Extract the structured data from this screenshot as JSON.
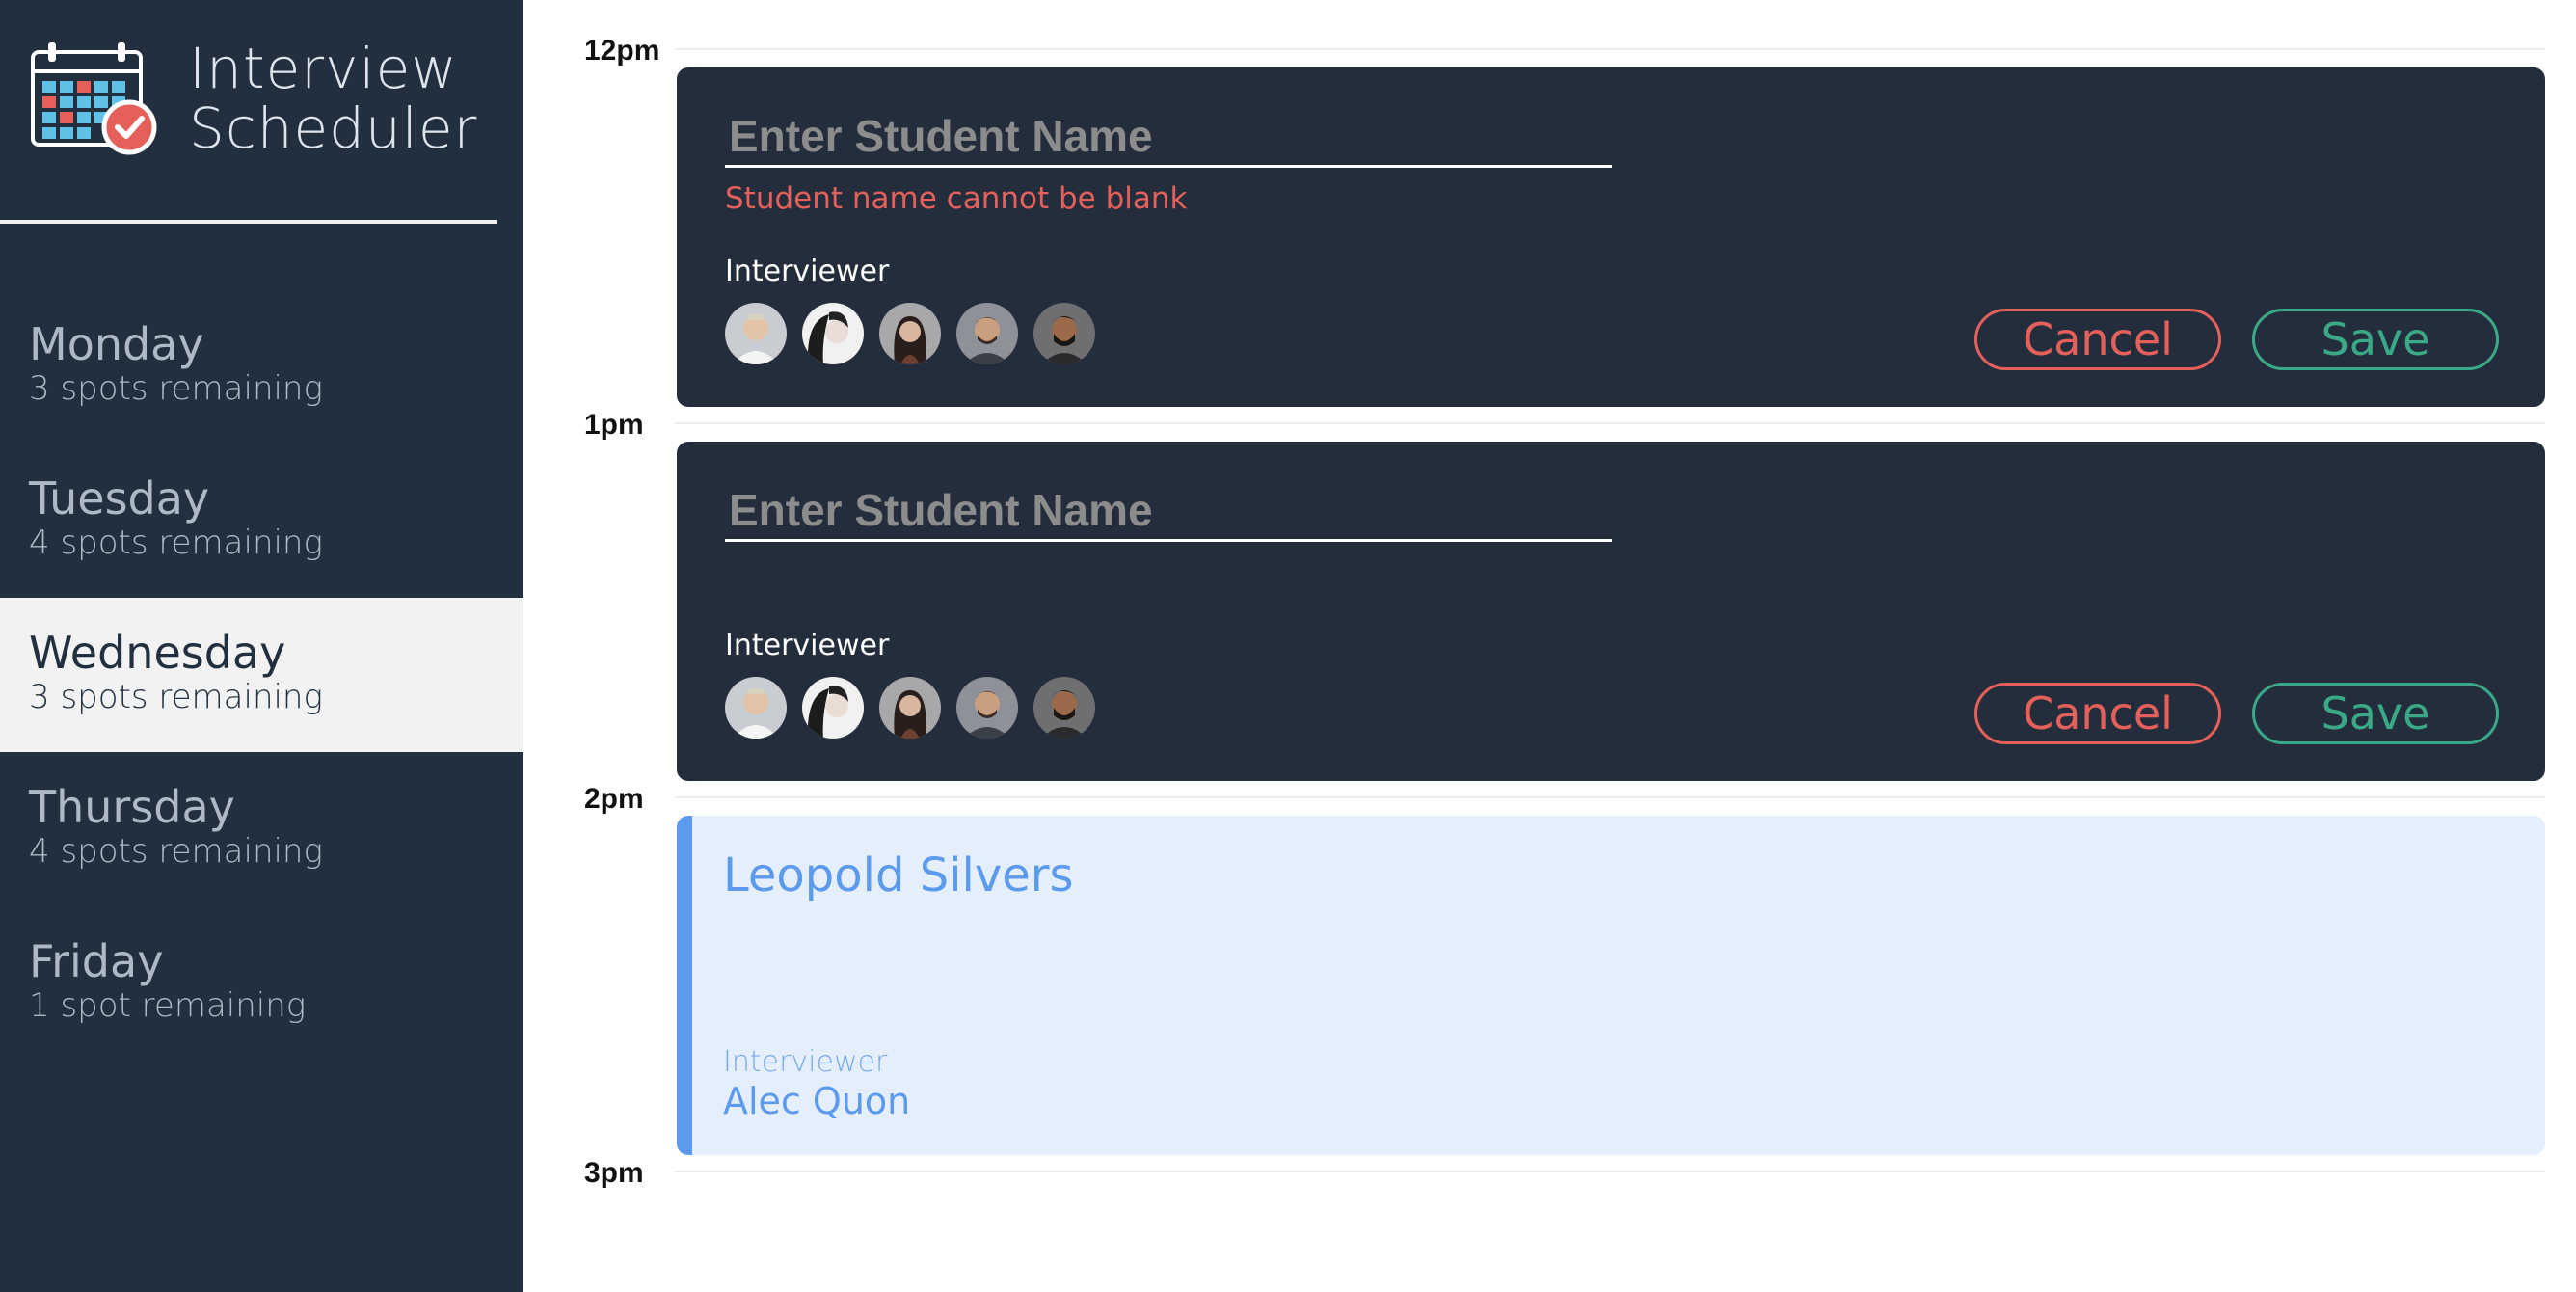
{
  "app": {
    "title_line1": "Interview",
    "title_line2": "Scheduler",
    "logo_icon": "calendar-check-icon"
  },
  "sidebar": {
    "days": [
      {
        "name": "Monday",
        "spots": "3 spots remaining",
        "selected": false
      },
      {
        "name": "Tuesday",
        "spots": "4 spots remaining",
        "selected": false
      },
      {
        "name": "Wednesday",
        "spots": "3 spots remaining",
        "selected": true
      },
      {
        "name": "Thursday",
        "spots": "4 spots remaining",
        "selected": false
      },
      {
        "name": "Friday",
        "spots": "1 spot remaining",
        "selected": false
      }
    ]
  },
  "schedule": {
    "times": [
      "12pm",
      "1pm",
      "2pm",
      "3pm"
    ],
    "forms": [
      {
        "placeholder": "Enter Student Name",
        "error": "Student name cannot be blank",
        "interviewer_label": "Interviewer",
        "cancel_label": "Cancel",
        "save_label": "Save"
      },
      {
        "placeholder": "Enter Student Name",
        "error": "",
        "interviewer_label": "Interviewer",
        "cancel_label": "Cancel",
        "save_label": "Save"
      }
    ],
    "appointment": {
      "student": "Leopold Silvers",
      "interviewer_label": "Interviewer",
      "interviewer_name": "Alec Quon"
    }
  },
  "colors": {
    "sidebar_bg": "#222f3e",
    "card_bg": "#242d3b",
    "error": "#e5605a",
    "save": "#3aaa86",
    "appointment_accent": "#5b9aec",
    "appointment_bg": "#e5effc"
  }
}
